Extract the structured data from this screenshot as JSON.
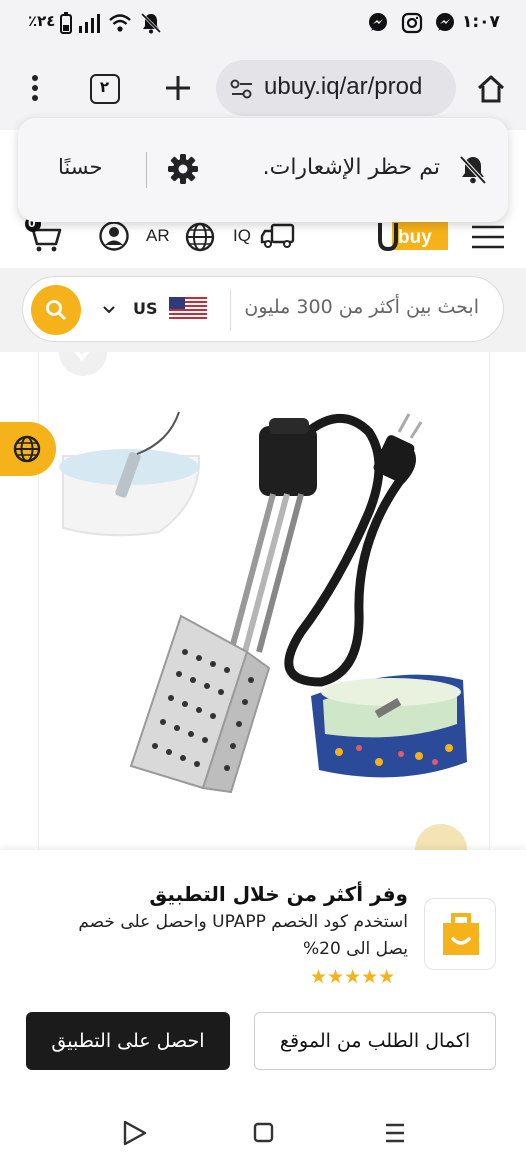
{
  "status_bar": {
    "time": "١:٠٧",
    "battery": "٪٢٤",
    "icons": [
      "messenger-icon",
      "instagram-icon",
      "messenger-icon",
      "battery-icon",
      "signal-icon",
      "wifi-icon",
      "muted-bell-icon"
    ]
  },
  "browser": {
    "url": "ubuy.iq/ar/prod",
    "tab_count": "٢",
    "icons": [
      "home-icon",
      "site-settings-icon",
      "new-tab-icon",
      "tabs-icon",
      "menu-icon"
    ]
  },
  "toast": {
    "message": "تم حظر الإشعارات.",
    "ok_label": "حسنًا"
  },
  "header": {
    "brand": "Ubuy",
    "country": "IQ",
    "language": "AR",
    "cart_count": "0",
    "accent_color": "#f5b21a"
  },
  "search": {
    "placeholder": "ابحث بين أكثر من 300 مليون",
    "store_code": "US"
  },
  "promo": {
    "title": "وفر أكثر من خلال التطبيق",
    "description_line1": "استخدم كود الخصم UPAPP واحصل على خصم",
    "description_line2": "يصل الى 20%",
    "rating_stars": "★★★★★",
    "get_app_label": "احصل على التطبيق",
    "continue_web_label": "اكمال الطلب من الموقع"
  },
  "nav": {
    "icons": [
      "back-icon",
      "home-square-icon",
      "recent-apps-icon"
    ]
  }
}
